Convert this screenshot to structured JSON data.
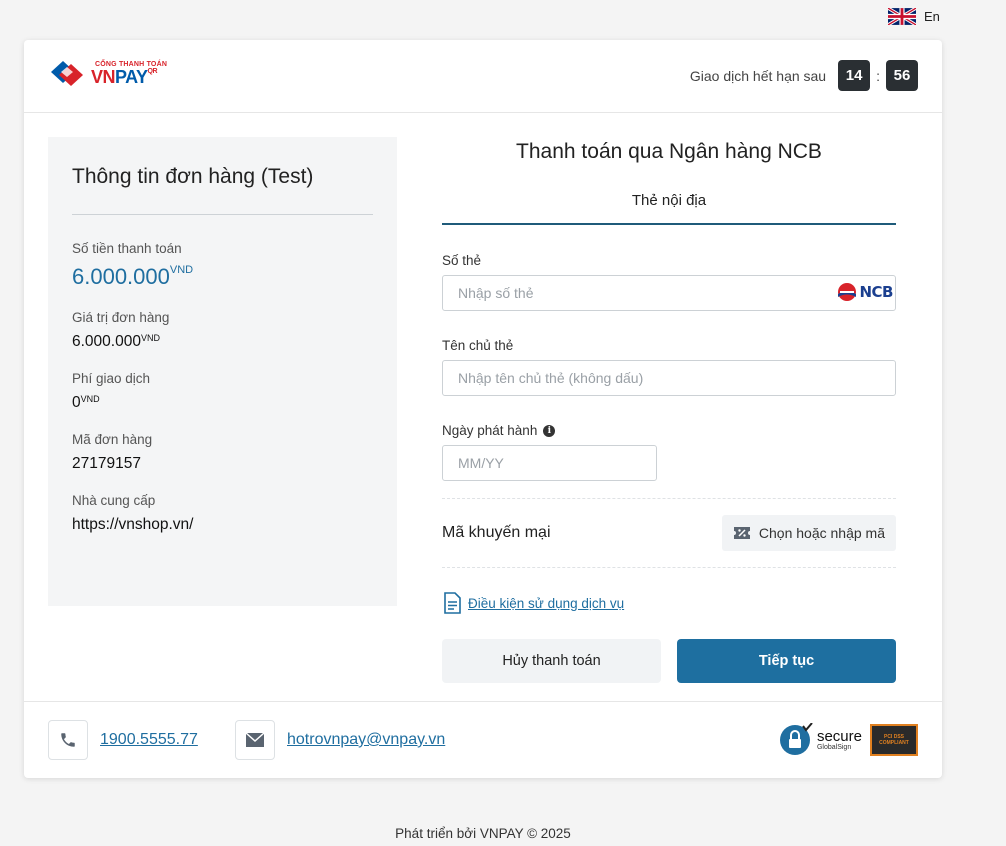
{
  "language": {
    "label": "En",
    "flag_icon": "uk-flag-icon"
  },
  "header": {
    "logo_small": "CỔNG THANH TOÁN",
    "logo_vn": "VN",
    "logo_pay": "PAY",
    "logo_qr": "QR",
    "timer_label": "Giao dịch hết hạn sau",
    "minutes": "14",
    "seconds": "56",
    "colon": ":"
  },
  "order": {
    "title": "Thông tin đơn hàng (Test)",
    "amount_label": "Số tiền thanh toán",
    "amount_value": "6.000.000",
    "order_value_label": "Giá trị đơn hàng",
    "order_value": "6.000.000",
    "fee_label": "Phí giao dịch",
    "fee_value": "0",
    "order_id_label": "Mã đơn hàng",
    "order_id": "27179157",
    "provider_label": "Nhà cung cấp",
    "provider": "https://vnshop.vn/",
    "currency": "VND"
  },
  "payment": {
    "title": "Thanh toán qua Ngân hàng NCB",
    "tab": "Thẻ nội địa",
    "card_number_label": "Số thẻ",
    "card_number_placeholder": "Nhập số thẻ",
    "bank_logo": "NCB",
    "holder_label": "Tên chủ thẻ",
    "holder_placeholder": "Nhập tên chủ thẻ (không dấu)",
    "issue_date_label": "Ngày phát hành",
    "issue_date_placeholder": "MM/YY",
    "promo_label": "Mã khuyến mại",
    "promo_button": "Chọn hoặc nhập mã",
    "terms": "Điều kiện sử dụng dịch vụ",
    "cancel": "Hủy thanh toán",
    "continue": "Tiếp tục"
  },
  "footer": {
    "phone": "1900.5555.77",
    "email": "hotrovnpay@vnpay.vn",
    "secure_label": "secure",
    "secure_sub": "GlobalSign",
    "pci_label": "PCI DSS COMPLIANT"
  },
  "page_footer": "Phát triển bởi VNPAY © 2025",
  "colors": {
    "primary": "#1e6fa0",
    "timer_bg": "#2a2f33",
    "brand_red": "#d8232a",
    "brand_blue": "#005baa"
  }
}
